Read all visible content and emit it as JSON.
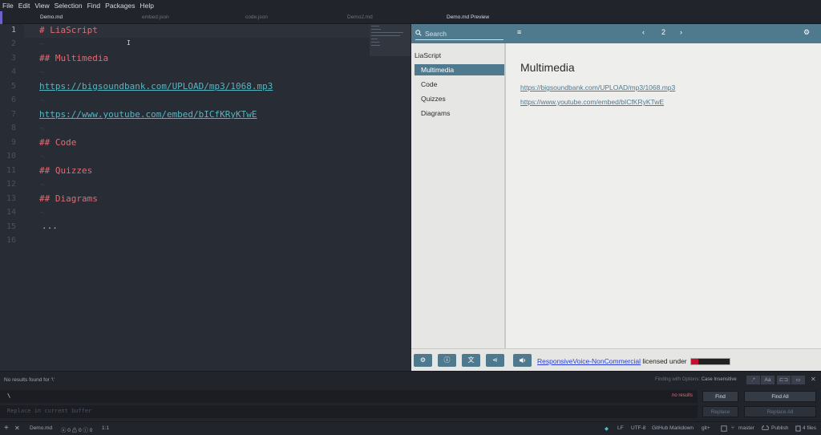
{
  "menu": [
    "File",
    "Edit",
    "View",
    "Selection",
    "Find",
    "Packages",
    "Help"
  ],
  "tabs": [
    {
      "label": "Demo.md",
      "active": true
    },
    {
      "label": "embed.json",
      "active": false
    },
    {
      "label": "code.json",
      "active": false
    },
    {
      "label": "Demo2.md",
      "active": false
    },
    {
      "label": "Demo.md Preview",
      "active": true
    }
  ],
  "editor": {
    "line_numbers": [
      "1",
      "2",
      "3",
      "4",
      "5",
      "6",
      "7",
      "8",
      "9",
      "10",
      "11",
      "12",
      "13",
      "14",
      "15",
      "16"
    ],
    "lines": {
      "l1": "# LiaScript",
      "l3": "## Multimedia",
      "l5": "https://bigsoundbank.com/UPLOAD/mp3/1068.mp3",
      "l7": "https://www.youtube.com/embed/bICfKRyKTwE",
      "l9": "## Code",
      "l11": "## Quizzes",
      "l13": "## Diagrams",
      "l15": "..."
    },
    "invisible_marker": "¬"
  },
  "preview": {
    "search_placeholder": "Search",
    "menu_icon": "≡",
    "prev_icon": "‹",
    "page": "2",
    "next_icon": "›",
    "mode_icon": "⚙",
    "toc": [
      {
        "label": "LiaScript",
        "active": false,
        "sub": false
      },
      {
        "label": "Multimedia",
        "active": true,
        "sub": true
      },
      {
        "label": "Code",
        "active": false,
        "sub": true
      },
      {
        "label": "Quizzes",
        "active": false,
        "sub": true
      },
      {
        "label": "Diagrams",
        "active": false,
        "sub": true
      }
    ],
    "heading": "Multimedia",
    "links": [
      "https://bigsoundbank.com/UPLOAD/mp3/1068.mp3",
      "https://www.youtube.com/embed/bICfKRyKTwE"
    ],
    "footer": {
      "settings_icon": "⚙",
      "info_icon": "ⓘ",
      "translate_icon": "文",
      "share_icon": "⋖",
      "sound_icon": "🔊",
      "rv_link": "ResponsiveVoice-NonCommercial",
      "rv_text": " licensed under "
    },
    "accent_color": "#4f7a8e"
  },
  "find": {
    "message": "No results found for '\\'",
    "options_prefix": "Finding with Options:",
    "options_value": "Case Insensitive",
    "option_buttons": [
      ".*",
      "Aa",
      "⊏⊐",
      "▭"
    ],
    "close_icon": "✕",
    "find_value": "\\",
    "no_results": "no results",
    "find_button": "Find",
    "find_all_button": "Find All",
    "replace_placeholder": "Replace in current buffer",
    "replace_button": "Replace",
    "replace_all_button": "Replace All"
  },
  "status": {
    "add_icon": "+",
    "close_icon": "✕",
    "file": "Demo.md",
    "diagnostics": "ⓧ 0 ⚠ 0 ⓘ 0",
    "cursor": "1:1",
    "dot_icon": "◆",
    "line_ending": "LF",
    "encoding": "UTF-8",
    "grammar": "GitHub Markdown",
    "git": "git+",
    "branch_icon": "⑂",
    "branch": "master",
    "publish": "Publish",
    "files": "4 files"
  }
}
